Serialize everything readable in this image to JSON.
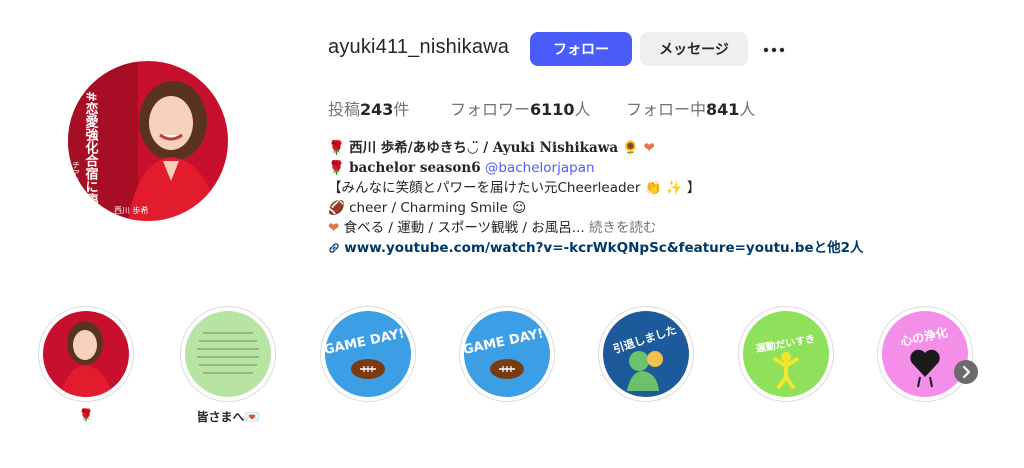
{
  "profile": {
    "username": "ayuki411_nishikawa",
    "follow_label": "フォロー",
    "message_label": "メッセージ",
    "more_icon": "more-horizontal-icon",
    "avatar_text_1": "#恋愛強化合宿に臨む",
    "avatar_text_2": "チアリーダー",
    "avatar_text_3": "西川 歩希"
  },
  "stats": {
    "posts_label": "投稿",
    "posts_value": "243",
    "posts_unit": "件",
    "followers_label": "フォロワー",
    "followers_value": "6110",
    "followers_unit": "人",
    "following_label": "フォロー中",
    "following_value": "841",
    "following_unit": "人"
  },
  "bio": {
    "name_line": "西川 歩希/あゆきち◡̈ / Ayuki Nishikawa",
    "show_line": "bachelor season6",
    "mention": "@bachelorjapan",
    "line3": "【みんなに笑顔とパワーを届けたい元Cheerleader",
    "line3_end": "】",
    "line4": "cheer / Charming Smile ☺",
    "line5": "食べる / 運動 / スポーツ観戦 / お風呂...",
    "more_label": "続きを読む",
    "link": "www.youtube.com/watch?v=-kcrWkQNpSc&feature=youtu.beと他2人"
  },
  "highlights": [
    {
      "label": "🌹",
      "cover": "portrait"
    },
    {
      "label": "皆さまへ💌",
      "cover": "letter"
    },
    {
      "label": "",
      "cover": "game-day",
      "text": "GAME DAY!!"
    },
    {
      "label": "",
      "cover": "game-day",
      "text": "GAME DAY!!"
    },
    {
      "label": "",
      "cover": "moved",
      "text": "引退しました"
    },
    {
      "label": "",
      "cover": "exercise",
      "text": "運動だいすき"
    },
    {
      "label": "",
      "cover": "heart",
      "text": "心の浄化"
    }
  ],
  "colors": {
    "follow_button": "#4a5dfa",
    "message_button": "#efefef",
    "mention": "#4a5dfa",
    "link": "#00376b",
    "game_day_bg": "#3c9ee5",
    "moved_bg": "#1d5a9c",
    "exercise_bg": "#8fe05a",
    "heart_bg": "#f48ee8",
    "letter_bg": "#b7e4a3"
  }
}
